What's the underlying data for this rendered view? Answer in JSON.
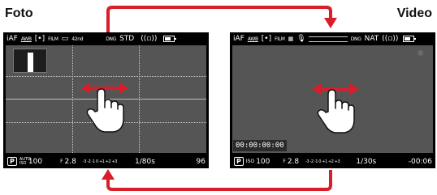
{
  "titles": {
    "photo": "Foto",
    "video": "Video"
  },
  "colors": {
    "arrow_red": "#d81e2a",
    "screen_bg": "#000000",
    "viewfinder_gray": "#555555"
  },
  "photo_screen": {
    "top": {
      "af_mode": "iAF",
      "wb_mode": "AWB",
      "metering_icon": "spot-metering-icon",
      "film_style": "FILM",
      "frame_icon": "aspect-frame-icon",
      "drive_mode": "42nd",
      "file_format": "DNG",
      "style_label": "STD",
      "stabilization_icon": "stabilization-icon",
      "battery_icon": "battery-icon"
    },
    "bottom": {
      "mode": "P",
      "iso_label": "AUTO ISO",
      "iso_value": "100",
      "aperture_prefix": "F",
      "aperture": "2.8",
      "ev_scale": "-3 -2 -1 0 +1 +2 +3",
      "shutter": "1/80s",
      "shots_remaining": "96"
    }
  },
  "video_screen": {
    "top": {
      "af_mode": "iAF",
      "wb_mode": "AWB",
      "metering_icon": "spot-metering-icon",
      "film_style": "FILM",
      "frame_icon": "video-resolution-icon",
      "mic_icon": "microphone-icon",
      "level_meter": "audio-level-meter",
      "file_format": "DNG",
      "style_label": "NAT",
      "stabilization_icon": "stabilization-icon",
      "battery_icon": "battery-icon"
    },
    "timecode": "00:00:00:00",
    "bottom": {
      "mode": "P",
      "iso_label": "ISO",
      "iso_value": "100",
      "aperture_prefix": "F",
      "aperture": "2.8",
      "ev_scale": "-3 -2 -1 0 +1 +2 +3",
      "shutter": "1/30s",
      "remaining_time": "-00:06"
    }
  }
}
